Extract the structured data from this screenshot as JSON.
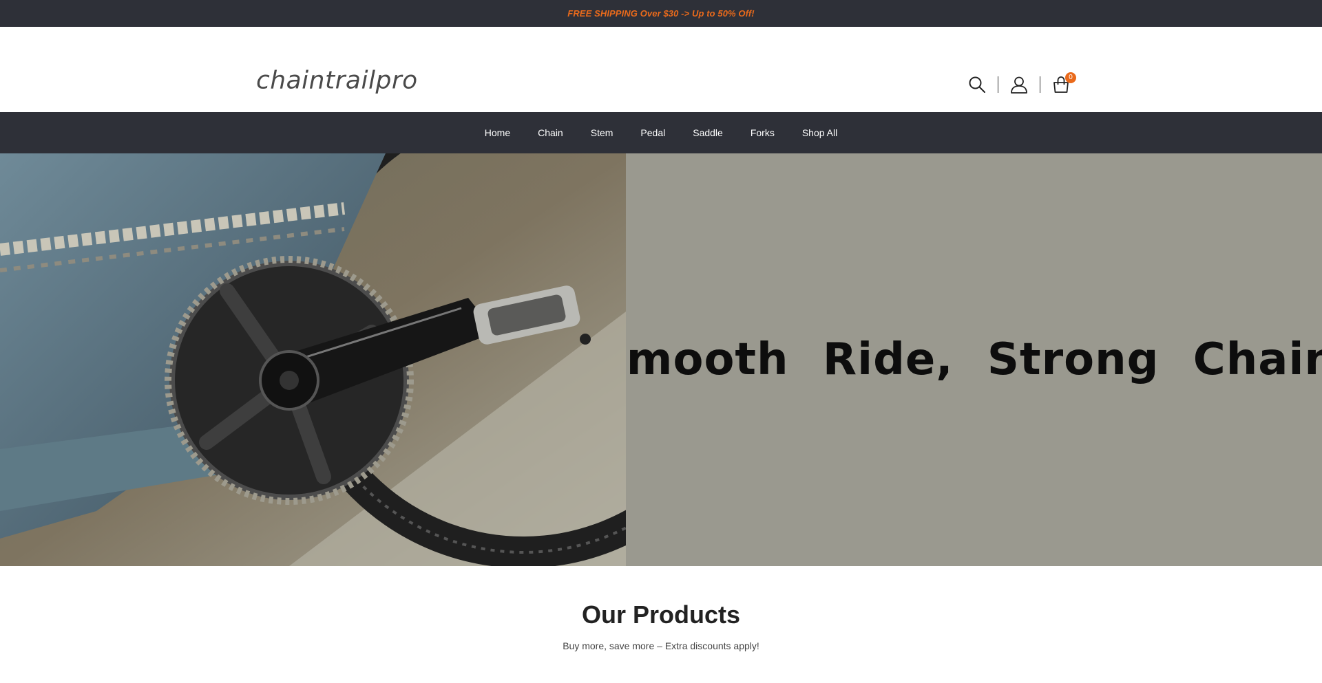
{
  "announcement": {
    "text": "FREE SHIPPING Over $30 -> Up to 50% Off!"
  },
  "header": {
    "logo_text": "chaintrailpro",
    "icons": [
      "search-icon",
      "user-icon",
      "cart-icon"
    ],
    "cart_count": "0"
  },
  "nav": {
    "items": [
      "Home",
      "Chain",
      "Stem",
      "Pedal",
      "Saddle",
      "Forks",
      "Shop All"
    ]
  },
  "hero": {
    "headline": "Smooth Ride, Strong Chain."
  },
  "products": {
    "title": "Our Products",
    "subtitle": "Buy more, save more – Extra discounts apply!"
  },
  "colors": {
    "dark_bar": "#2e3038",
    "accent": "#ea6a1b",
    "hero_panel": "#9a998f"
  }
}
